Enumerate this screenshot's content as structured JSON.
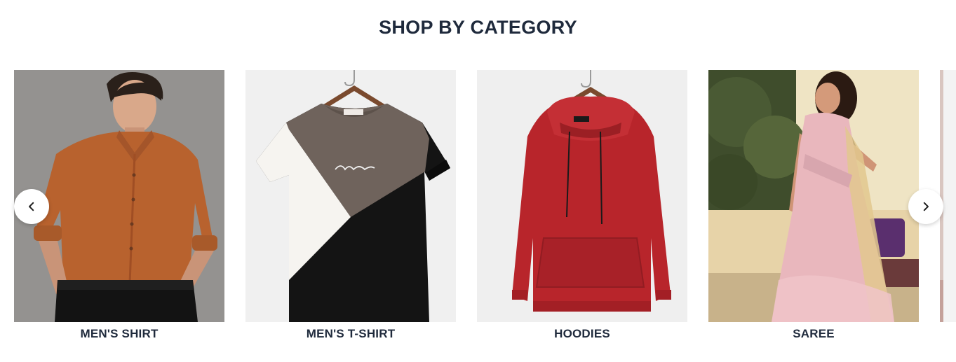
{
  "section": {
    "title": "SHOP BY CATEGORY"
  },
  "carousel": {
    "prev_icon": "chevron-left-icon",
    "next_icon": "chevron-right-icon",
    "items": [
      {
        "label": "MEN'S SHIRT"
      },
      {
        "label": "MEN'S T-SHIRT"
      },
      {
        "label": "HOODIES"
      },
      {
        "label": "SAREE"
      }
    ]
  },
  "colors": {
    "heading": "#1f2a3c",
    "shirt": "#b8622e",
    "hoodie": "#b8252b",
    "saree": "#e9b7bd"
  }
}
